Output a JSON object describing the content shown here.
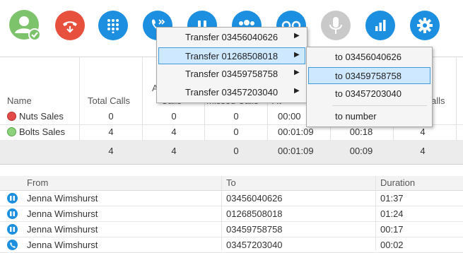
{
  "toolbar": {
    "buttons": [
      {
        "name": "status-icon",
        "color": "#7cc36c"
      },
      {
        "name": "hangup-icon",
        "color": "#e8503e"
      },
      {
        "name": "dialpad-icon",
        "color": "#1d8fe0"
      },
      {
        "name": "transfer-icon",
        "color": "#1d8fe0"
      },
      {
        "name": "hold-icon",
        "color": "#1d8fe0"
      },
      {
        "name": "conference-icon",
        "color": "#1d8fe0"
      },
      {
        "name": "voicemail-icon",
        "color": "#1d8fe0"
      },
      {
        "name": "microphone-icon",
        "color": "#c9c9c9"
      },
      {
        "name": "stats-icon",
        "color": "#1d8fe0"
      },
      {
        "name": "settings-icon",
        "color": "#1d8fe0"
      }
    ]
  },
  "queue_table": {
    "headers": {
      "name": "Name",
      "total_calls": "Total Calls",
      "answered_partial_top": "A",
      "answered_partial_bottom": "Calls",
      "missed_partial": "Missed Calls",
      "avg_partial": "Av",
      "longest_partial": "alls"
    },
    "rows": [
      {
        "name": "Nuts Sales",
        "status": "red",
        "total": "0",
        "answered": "0",
        "missed": "0",
        "time": "00:00",
        "wait": "",
        "calls": ""
      },
      {
        "name": "Bolts Sales",
        "status": "green",
        "total": "4",
        "answered": "4",
        "missed": "0",
        "time": "00:01:09",
        "wait": "00:18",
        "calls": "4"
      }
    ],
    "totals": {
      "total": "4",
      "answered": "4",
      "missed": "0",
      "time": "00:01:09",
      "wait": "00:09",
      "calls": "4"
    }
  },
  "calls_list": {
    "headers": {
      "from": "From",
      "to": "To",
      "duration": "Duration"
    },
    "rows": [
      {
        "icon": "hold-icon",
        "from": "Jenna Wimshurst",
        "to": "03456040626",
        "duration": "01:37"
      },
      {
        "icon": "hold-icon",
        "from": "Jenna Wimshurst",
        "to": "01268508018",
        "duration": "01:24"
      },
      {
        "icon": "hold-icon",
        "from": "Jenna Wimshurst",
        "to": "03459758758",
        "duration": "00:17"
      },
      {
        "icon": "phone-icon",
        "from": "Jenna Wimshurst",
        "to": "03457203040",
        "duration": "00:02"
      }
    ]
  },
  "transfer_menu": {
    "items": [
      {
        "label": "Transfer 03456040626",
        "selected": false
      },
      {
        "label": "Transfer 01268508018",
        "selected": true
      },
      {
        "label": "Transfer 03459758758",
        "selected": false
      },
      {
        "label": "Transfer 03457203040",
        "selected": false
      }
    ]
  },
  "submenu": {
    "items": [
      {
        "label": "to 03456040626",
        "selected": false
      },
      {
        "label": "to 03459758758",
        "selected": true
      },
      {
        "label": "to 03457203040",
        "selected": false
      }
    ],
    "extra": "to number"
  }
}
